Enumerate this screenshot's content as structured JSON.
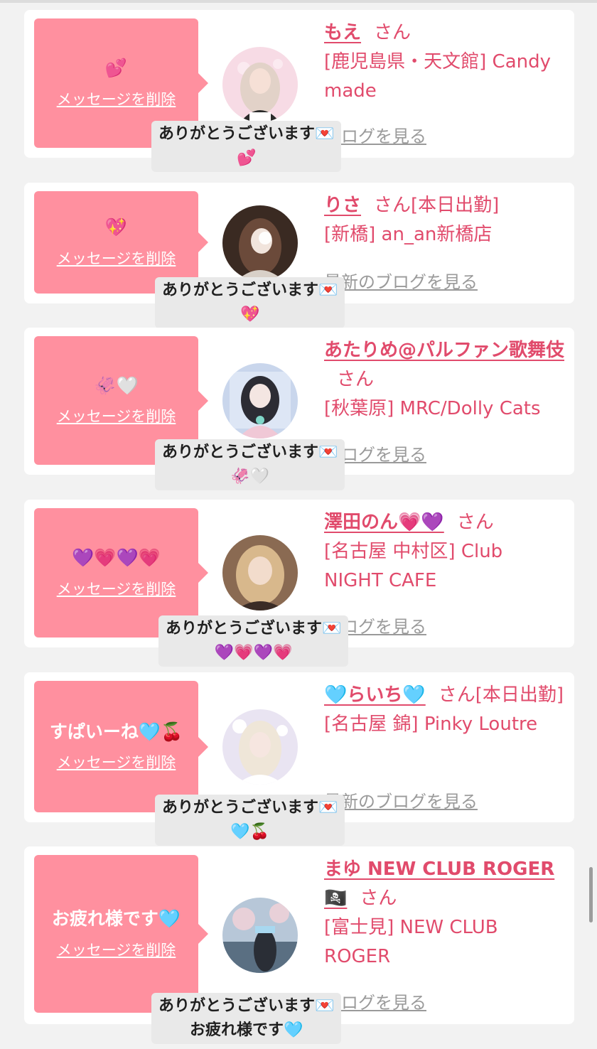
{
  "delete_label": "メッセージを削除",
  "blog_label": "最新のブログを見る",
  "blog_visible": "ブログを見る",
  "san": "さん",
  "reply_text": "ありがとうございます💌",
  "colors": {
    "page_bg": "#f2f2f2",
    "bubble": "#ff909f",
    "name": "#e14b6c",
    "link_grey": "#9a9a9a",
    "reply_bg": "#e9e9e9"
  },
  "items": [
    {
      "bubble_msg": "💕",
      "name": "もえ",
      "status": "",
      "location": "[鹿児島県・天文館] Candy made",
      "reply_emoji": "💕"
    },
    {
      "bubble_msg": "💖",
      "name": "りさ",
      "status": "[本日出勤]",
      "location": "[新橋] an_an新橋店",
      "reply_emoji": "💖"
    },
    {
      "bubble_msg": "🦑🤍",
      "name": "あたりめ@パルファン歌舞伎",
      "status": "",
      "location": "[秋葉原] MRC/Dolly Cats",
      "reply_emoji": "🦑🤍"
    },
    {
      "bubble_msg": "💜💗💜💗",
      "name": "澤田のん💗💜",
      "status": "",
      "location": "[名古屋 中村区] Club NIGHT CAFE",
      "reply_emoji": "💜💗💜💗"
    },
    {
      "bubble_msg": "すぱいーね🩵🍒",
      "name": "🩵らいち🩵",
      "status": "[本日出勤]",
      "location": "[名古屋 錦] Pinky Loutre",
      "reply_emoji": "🩵🍒"
    },
    {
      "bubble_msg": "お疲れ様です🩵",
      "name": "まゆ NEW CLUB ROGER 🏴‍☠️",
      "status": "",
      "location": "[富士見] NEW CLUB ROGER",
      "reply_emoji": "お疲れ様です🩵"
    }
  ]
}
